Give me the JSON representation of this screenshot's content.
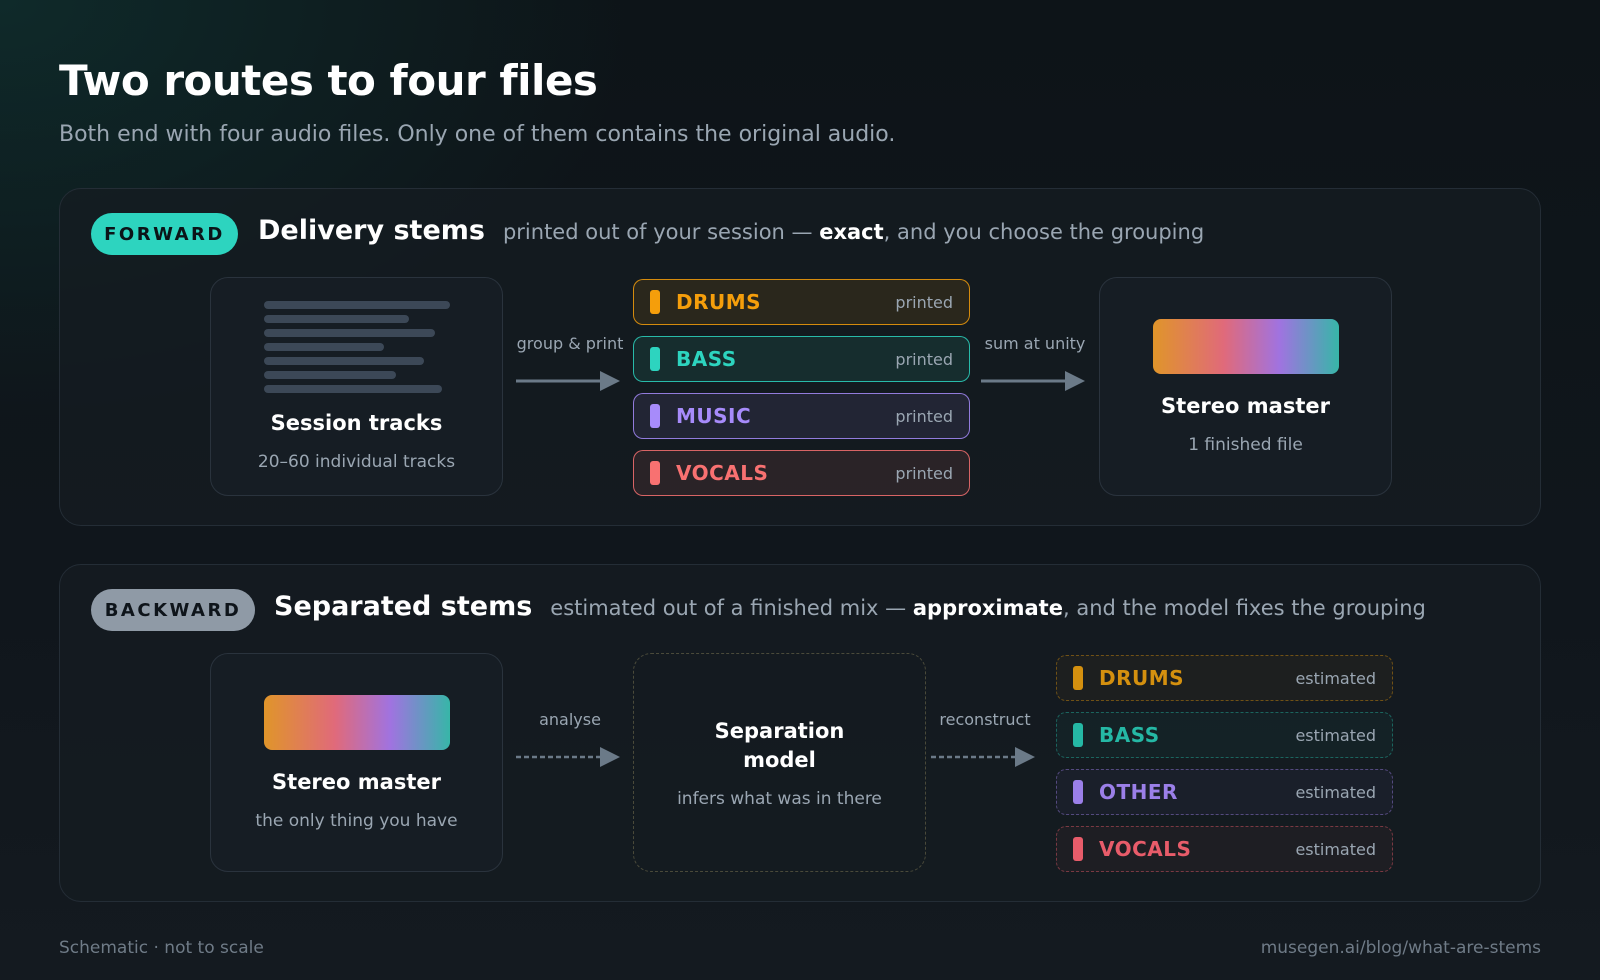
{
  "title": "Two routes to four files",
  "subtitle": "Both end with four audio files. Only one of them contains the original audio.",
  "forward": {
    "pill": "FORWARD",
    "name": "Delivery stems",
    "desc_pre": "printed out of your session —",
    "desc_bold": "exact",
    "desc_post": ", and you choose the grouping",
    "source": {
      "title": "Session tracks",
      "sub": "20–60 individual tracks"
    },
    "arrow1_label": "group & print",
    "stems": [
      {
        "name": "DRUMS",
        "tag": "printed",
        "color": "#f59e0b"
      },
      {
        "name": "BASS",
        "tag": "printed",
        "color": "#2dd4bf"
      },
      {
        "name": "MUSIC",
        "tag": "printed",
        "color": "#a78bfa"
      },
      {
        "name": "VOCALS",
        "tag": "printed",
        "color": "#f87171"
      }
    ],
    "arrow2_label": "sum at unity",
    "result": {
      "title": "Stereo master",
      "sub": "1 finished file"
    }
  },
  "backward": {
    "pill": "BACKWARD",
    "name": "Separated stems",
    "desc_pre": "estimated out of a finished mix —",
    "desc_bold": "approximate",
    "desc_post": ", and the model fixes the grouping",
    "source": {
      "title": "Stereo master",
      "sub": "the only thing you have"
    },
    "arrow1_label": "analyse",
    "model": {
      "title_line1": "Separation",
      "title_line2": "model",
      "sub": "infers what was in there"
    },
    "arrow2_label": "reconstruct",
    "stems": [
      {
        "name": "DRUMS",
        "tag": "estimated",
        "color": "#d4900f"
      },
      {
        "name": "BASS",
        "tag": "estimated",
        "color": "#25b8a5"
      },
      {
        "name": "OTHER",
        "tag": "estimated",
        "color": "#9b7fe8"
      },
      {
        "name": "VOCALS",
        "tag": "estimated",
        "color": "#e85c6a"
      }
    ]
  },
  "footer": {
    "left": "Schematic · not to scale",
    "right": "musegen.ai/blog/what-are-stems"
  }
}
